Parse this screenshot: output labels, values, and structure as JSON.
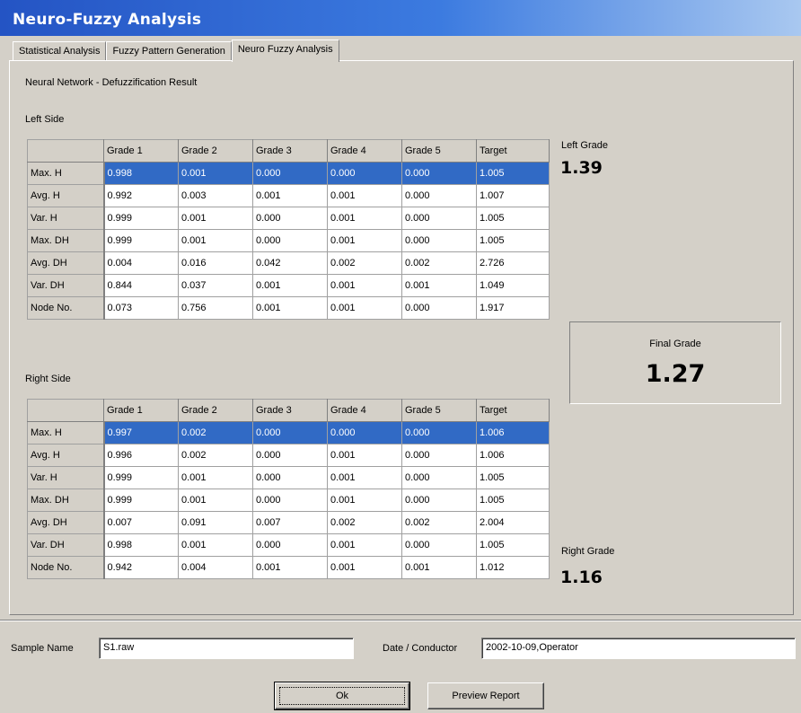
{
  "window": {
    "title": "Neuro-Fuzzy Analysis"
  },
  "tabs": [
    {
      "label": "Statistical Analysis"
    },
    {
      "label": "Fuzzy Pattern Generation"
    },
    {
      "label": "Neuro Fuzzy Analysis",
      "active": true
    }
  ],
  "section_title": "Neural Network - Defuzzification Result",
  "columns": [
    "Grade 1",
    "Grade 2",
    "Grade 3",
    "Grade 4",
    "Grade 5",
    "Target"
  ],
  "left": {
    "label": "Left Side",
    "rows": [
      {
        "name": "Max. H",
        "values": [
          "0.998",
          "0.001",
          "0.000",
          "0.000",
          "0.000",
          "1.005"
        ],
        "selected": true
      },
      {
        "name": "Avg. H",
        "values": [
          "0.992",
          "0.003",
          "0.001",
          "0.001",
          "0.000",
          "1.007"
        ]
      },
      {
        "name": "Var. H",
        "values": [
          "0.999",
          "0.001",
          "0.000",
          "0.001",
          "0.000",
          "1.005"
        ]
      },
      {
        "name": "Max. DH",
        "values": [
          "0.999",
          "0.001",
          "0.000",
          "0.001",
          "0.000",
          "1.005"
        ]
      },
      {
        "name": "Avg. DH",
        "values": [
          "0.004",
          "0.016",
          "0.042",
          "0.002",
          "0.002",
          "2.726"
        ]
      },
      {
        "name": "Var. DH",
        "values": [
          "0.844",
          "0.037",
          "0.001",
          "0.001",
          "0.001",
          "1.049"
        ]
      },
      {
        "name": "Node No.",
        "values": [
          "0.073",
          "0.756",
          "0.001",
          "0.001",
          "0.000",
          "1.917"
        ]
      }
    ],
    "grade_label": "Left Grade",
    "grade_value": "1.39"
  },
  "right": {
    "label": "Right Side",
    "rows": [
      {
        "name": "Max. H",
        "values": [
          "0.997",
          "0.002",
          "0.000",
          "0.000",
          "0.000",
          "1.006"
        ],
        "selected": true
      },
      {
        "name": "Avg. H",
        "values": [
          "0.996",
          "0.002",
          "0.000",
          "0.001",
          "0.000",
          "1.006"
        ]
      },
      {
        "name": "Var. H",
        "values": [
          "0.999",
          "0.001",
          "0.000",
          "0.001",
          "0.000",
          "1.005"
        ]
      },
      {
        "name": "Max. DH",
        "values": [
          "0.999",
          "0.001",
          "0.000",
          "0.001",
          "0.000",
          "1.005"
        ]
      },
      {
        "name": "Avg. DH",
        "values": [
          "0.007",
          "0.091",
          "0.007",
          "0.002",
          "0.002",
          "2.004"
        ]
      },
      {
        "name": "Var. DH",
        "values": [
          "0.998",
          "0.001",
          "0.000",
          "0.001",
          "0.000",
          "1.005"
        ]
      },
      {
        "name": "Node No.",
        "values": [
          "0.942",
          "0.004",
          "0.001",
          "0.001",
          "0.001",
          "1.012"
        ]
      }
    ],
    "grade_label": "Right Grade",
    "grade_value": "1.16"
  },
  "final": {
    "label": "Final Grade",
    "value": "1.27"
  },
  "footer": {
    "sample_label": "Sample Name",
    "sample_value": "S1.raw",
    "date_label": "Date / Conductor",
    "date_value": "2002-10-09,Operator",
    "ok_label": "Ok",
    "preview_label": "Preview Report"
  },
  "colors": {
    "selection": "#316ac5",
    "titlebar": "#2454c4",
    "face": "#d4d0c8"
  }
}
